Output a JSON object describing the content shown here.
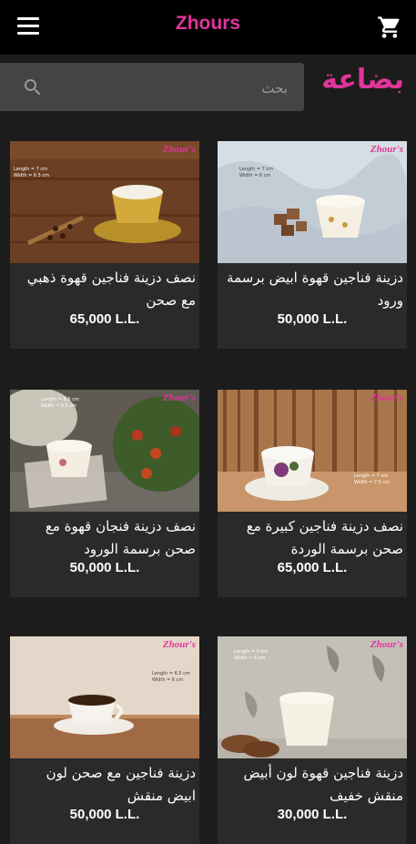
{
  "header": {
    "title": "Zhours",
    "menu_icon": "menu-icon",
    "cart_icon": "cart-icon"
  },
  "search": {
    "placeholder": "بحث",
    "value": ""
  },
  "section": {
    "title": "بضاعة"
  },
  "brand_mark": "Zhour's",
  "colors": {
    "accent": "#e0359a",
    "background": "#1c1c1c",
    "card": "#2a2a2a",
    "topbar": "#000000"
  },
  "products": [
    {
      "name": "نصف دزينة فناجين قهوة ذهبي مع صحن",
      "price": "65,000 L.L.",
      "dims": "Length = 7 cm\nWidth = 6.5 cm"
    },
    {
      "name": "دزينة فناجين قهوة ابيض برسمة ورود",
      "price": "50,000 L.L.",
      "dims": "Length = 7 cm\nWidth = 6 cm"
    },
    {
      "name": "نصف دزينة فنجان قهوة مع صحن برسمة الورود",
      "price": "50,000 L.L.",
      "dims": "Length = 6.5 cm\nWidth = 6.5 cm"
    },
    {
      "name": "نصف دزينة فناجين كبيرة مع صحن برسمة الوردة",
      "price": "65,000 L.L.",
      "dims": "Length = 7 cm\nWidth = 7.5 cm"
    },
    {
      "name": "دزينة فناجين مع صحن لون ابيض منقش",
      "price": "50,000 L.L.",
      "dims": "Length = 6.5 cm\nWidth = 6 cm"
    },
    {
      "name": "دزينة فناجين قهوة لون أبيض منقش خفيف",
      "price": "30,000 L.L.",
      "dims": "Length = 5 cm\nWidth = 6 cm"
    }
  ]
}
